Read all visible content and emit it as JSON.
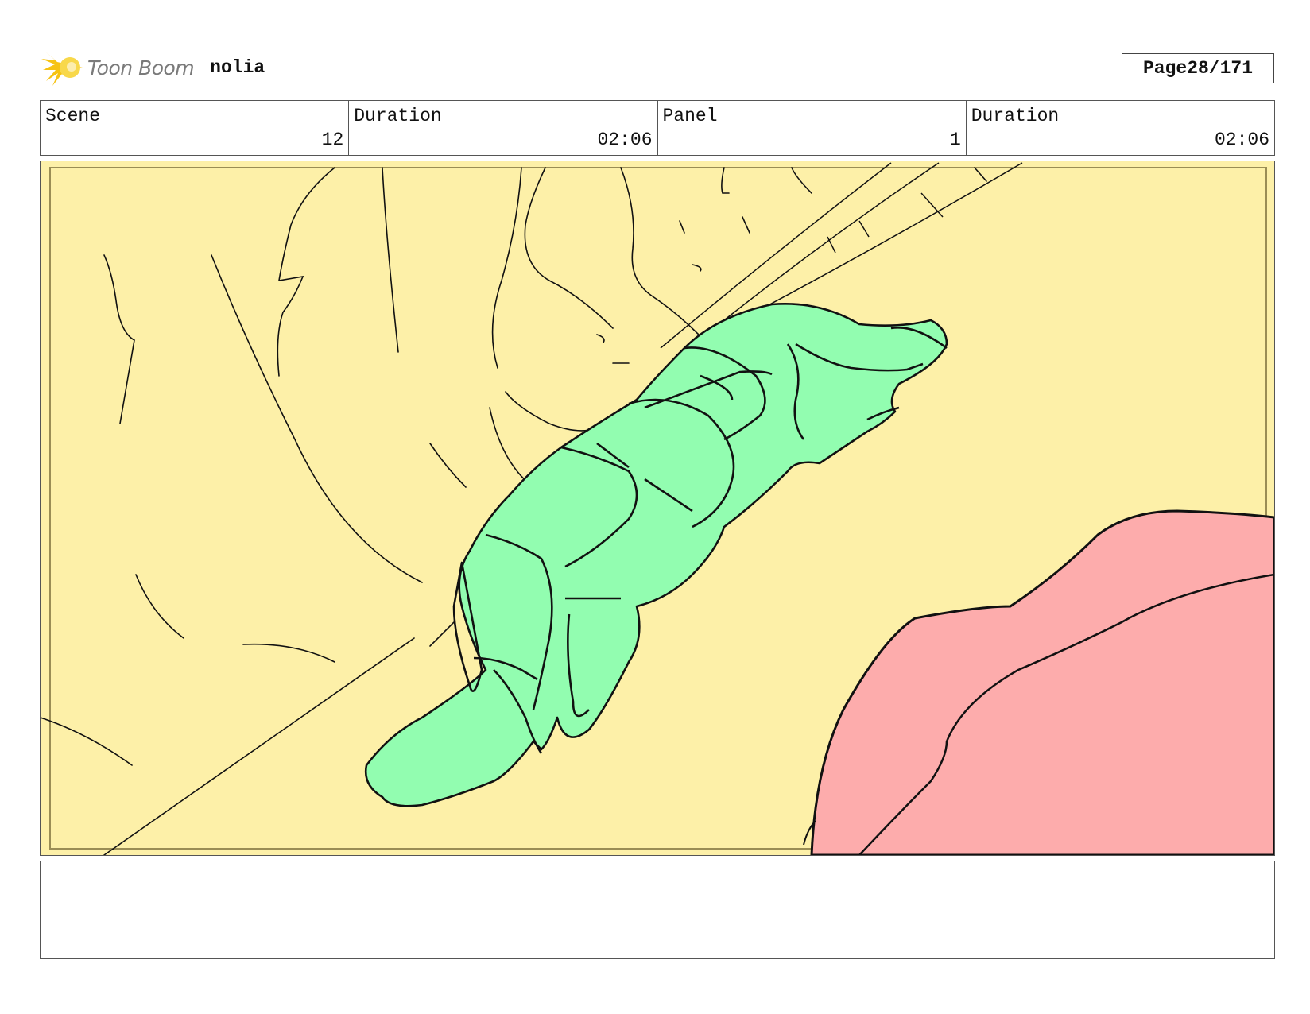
{
  "header": {
    "brand": "Toon Boom",
    "project": "nolia",
    "page_label": "Page",
    "page_value": "28/171"
  },
  "info": {
    "scene_label": "Scene",
    "scene_value": "12",
    "scene_duration_label": "Duration",
    "scene_duration_value": "02:06",
    "panel_label": "Panel",
    "panel_value": "1",
    "panel_duration_label": "Duration",
    "panel_duration_value": "02:06"
  },
  "notes": {
    "text": ""
  },
  "colors": {
    "background": "#fdf0a8",
    "character": "#92fdb0",
    "blanket": "#fdacac",
    "logo_accent": "#f6c313"
  },
  "icons": {
    "logo": "toon-boom-starburst-icon"
  }
}
